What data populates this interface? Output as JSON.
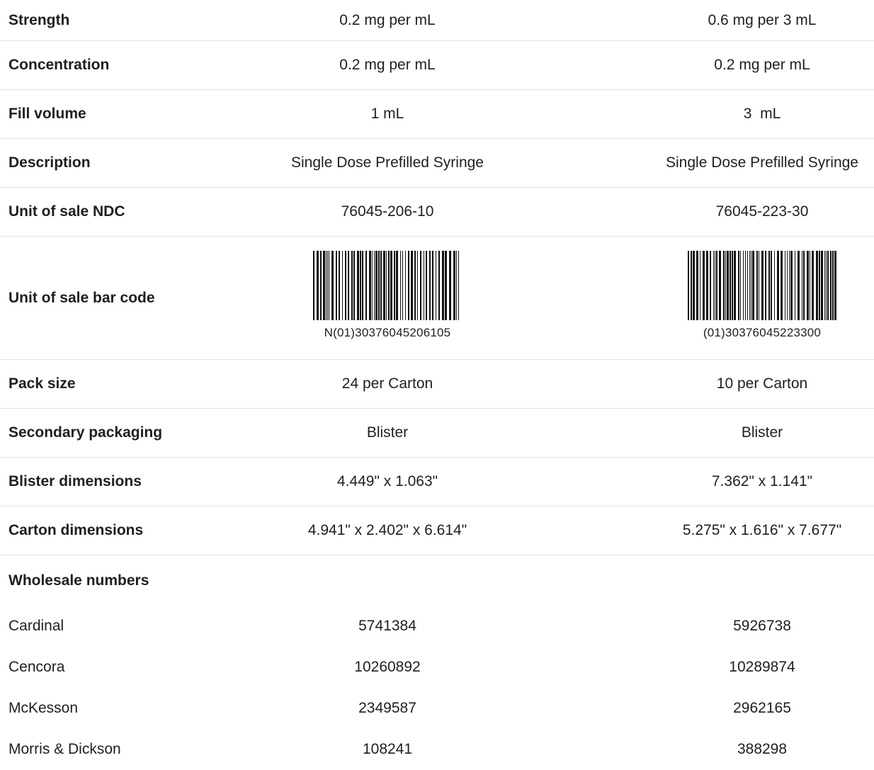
{
  "rows": [
    {
      "label": "Strength",
      "v1": "0.2 mg per mL",
      "v2": "0.6 mg per 3 mL"
    },
    {
      "label": "Concentration",
      "v1": "0.2 mg per mL",
      "v2": "0.2 mg per mL"
    },
    {
      "label": "Fill volume",
      "v1": "1 mL",
      "v2": "3  mL"
    },
    {
      "label": "Description",
      "v1": "Single Dose Prefilled Syringe",
      "v2": "Single Dose Prefilled Syringe"
    },
    {
      "label": "Unit of sale NDC",
      "v1": "76045-206-10",
      "v2": "76045-223-30"
    }
  ],
  "barcode_row": {
    "label": "Unit of sale bar code",
    "code1": "N(01)30376045206105",
    "code2": "(01)30376045223300"
  },
  "rows2": [
    {
      "label": "Pack size",
      "v1": "24 per Carton",
      "v2": "10 per Carton"
    },
    {
      "label": "Secondary packaging",
      "v1": "Blister",
      "v2": "Blister"
    },
    {
      "label": "Blister dimensions",
      "v1": "4.449\" x 1.063\"",
      "v2": "7.362\" x 1.141\""
    },
    {
      "label": "Carton dimensions",
      "v1": "4.941\" x 2.402\" x 6.614\"",
      "v2": "5.275\" x 1.616\" x 7.677\""
    }
  ],
  "wholesale": {
    "heading": "Wholesale numbers",
    "rows": [
      {
        "label": "Cardinal",
        "v1": "5741384",
        "v2": "5926738"
      },
      {
        "label": "Cencora",
        "v1": "10260892",
        "v2": "10289874"
      },
      {
        "label": "McKesson",
        "v1": "2349587",
        "v2": "2962165"
      },
      {
        "label": "Morris & Dickson",
        "v1": "108241",
        "v2": "388298"
      }
    ]
  }
}
